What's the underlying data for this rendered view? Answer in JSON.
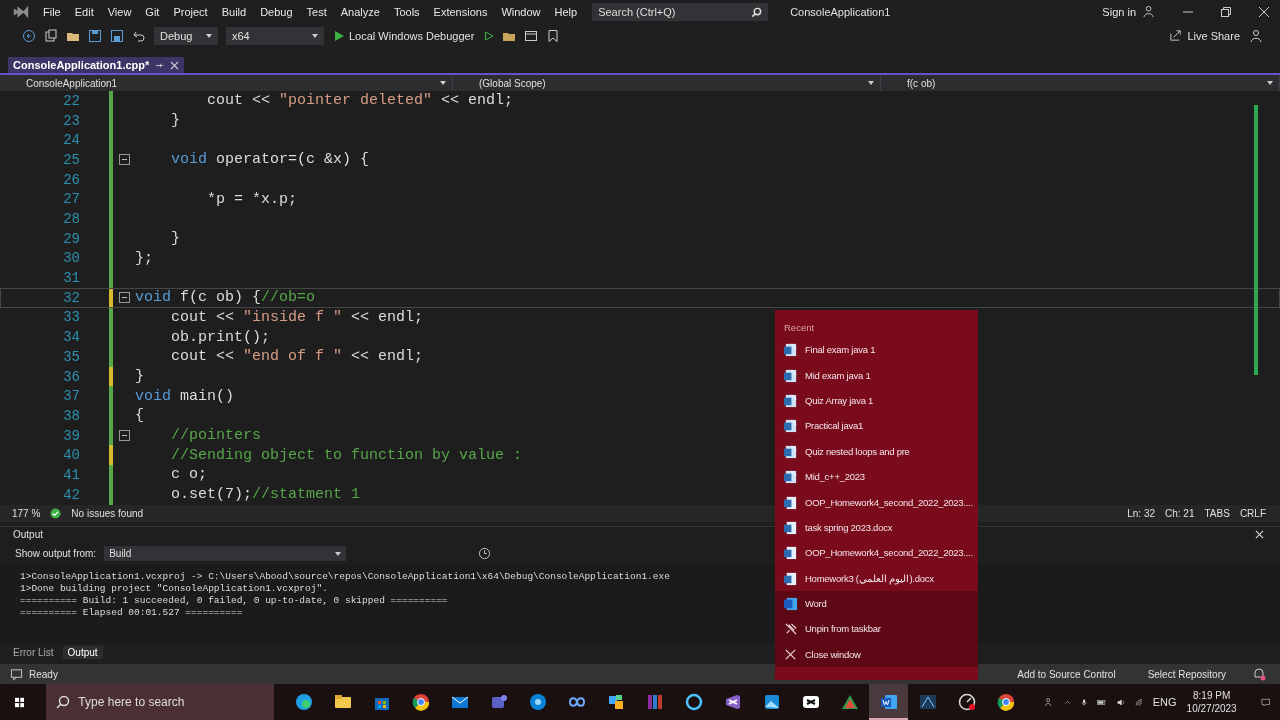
{
  "menu_bar": {
    "items": [
      "File",
      "Edit",
      "View",
      "Git",
      "Project",
      "Build",
      "Debug",
      "Test",
      "Analyze",
      "Tools",
      "Extensions",
      "Window",
      "Help"
    ],
    "search": {
      "placeholder": "Search (Ctrl+Q)"
    },
    "title": "ConsoleApplication1",
    "sign_in": "Sign in"
  },
  "toolbar": {
    "configuration": "Debug",
    "platform": "x64",
    "debugger": "Local Windows Debugger",
    "live_share": "Live Share"
  },
  "editor": {
    "tab": {
      "label": "ConsoleApplication1.cpp*",
      "selected": true
    },
    "nav": {
      "project": "ConsoleApplication1",
      "scope": "(Global Scope)",
      "member": "f(c ob)"
    },
    "lines": [
      {
        "number": "22",
        "current": false,
        "unsaved": false,
        "fold": false,
        "segments": [
          {
            "kind": "plain",
            "text": "        cout << "
          },
          {
            "kind": "string",
            "text": "\"pointer deleted\""
          },
          {
            "kind": "plain",
            "text": " << endl;"
          }
        ]
      },
      {
        "number": "23",
        "current": false,
        "unsaved": false,
        "fold": false,
        "segments": [
          {
            "kind": "plain",
            "text": "    }"
          }
        ]
      },
      {
        "number": "24",
        "current": false,
        "unsaved": false,
        "fold": false
      },
      {
        "number": "25",
        "current": false,
        "unsaved": false,
        "fold": true,
        "segments": [
          {
            "kind": "keyword",
            "text": "    void"
          },
          {
            "kind": "plain",
            "text": " operator=(c &x) {"
          }
        ]
      },
      {
        "number": "26",
        "current": false,
        "unsaved": false,
        "fold": false
      },
      {
        "number": "27",
        "current": false,
        "unsaved": false,
        "fold": false,
        "segments": [
          {
            "kind": "plain",
            "text": "        *p = *x.p;"
          }
        ]
      },
      {
        "number": "28",
        "current": false,
        "unsaved": false,
        "fold": false
      },
      {
        "number": "29",
        "current": false,
        "unsaved": false,
        "fold": false,
        "segments": [
          {
            "kind": "plain",
            "text": "    }"
          }
        ]
      },
      {
        "number": "30",
        "current": false,
        "unsaved": false,
        "fold": false,
        "segments": [
          {
            "kind": "plain",
            "text": "};"
          }
        ]
      },
      {
        "number": "31",
        "current": false,
        "unsaved": false,
        "fold": false
      },
      {
        "number": "32",
        "current": true,
        "unsaved": true,
        "fold": true,
        "segments": [
          {
            "kind": "keyword",
            "text": "void"
          },
          {
            "kind": "plain",
            "text": " f(c ob) {"
          },
          {
            "kind": "comment",
            "text": "//ob=o"
          }
        ]
      },
      {
        "number": "33",
        "current": false,
        "unsaved": false,
        "fold": false,
        "segments": [
          {
            "kind": "plain",
            "text": "    cout << "
          },
          {
            "kind": "string",
            "text": "\"inside f \""
          },
          {
            "kind": "plain",
            "text": " << endl;"
          }
        ]
      },
      {
        "number": "34",
        "current": false,
        "unsaved": false,
        "fold": false,
        "segments": [
          {
            "kind": "plain",
            "text": "    ob.print();"
          }
        ]
      },
      {
        "number": "35",
        "current": false,
        "unsaved": false,
        "fold": false,
        "segments": [
          {
            "kind": "plain",
            "text": "    cout << "
          },
          {
            "kind": "string",
            "text": "\"end of f \""
          },
          {
            "kind": "plain",
            "text": " << endl;"
          }
        ]
      },
      {
        "number": "36",
        "current": false,
        "unsaved": true,
        "fold": false,
        "segments": [
          {
            "kind": "plain",
            "text": "}"
          }
        ]
      },
      {
        "number": "37",
        "current": false,
        "unsaved": false,
        "fold": false,
        "segments": [
          {
            "kind": "keyword",
            "text": "void"
          },
          {
            "kind": "plain",
            "text": " main()"
          }
        ]
      },
      {
        "number": "38",
        "current": false,
        "unsaved": false,
        "fold": false,
        "segments": [
          {
            "kind": "plain",
            "text": "{"
          }
        ]
      },
      {
        "number": "39",
        "current": false,
        "unsaved": false,
        "fold": true,
        "segments": [
          {
            "kind": "comment",
            "text": "    //pointers"
          }
        ]
      },
      {
        "number": "40",
        "current": false,
        "unsaved": true,
        "fold": false,
        "segments": [
          {
            "kind": "comment",
            "text": "    //Sending object to function by value :"
          }
        ]
      },
      {
        "number": "41",
        "current": false,
        "unsaved": false,
        "fold": false,
        "segments": [
          {
            "kind": "plain",
            "text": "    c o;"
          }
        ]
      },
      {
        "number": "42",
        "current": false,
        "unsaved": false,
        "fold": false,
        "segments": [
          {
            "kind": "plain",
            "text": "    o.set(7);"
          },
          {
            "kind": "comment",
            "text": "//statment 1"
          }
        ]
      }
    ],
    "status": {
      "zoom": "177 %",
      "issues": "No issues found",
      "line": "Ln: 32",
      "column": "Ch: 21",
      "indent": "TABS",
      "line_endings": "CRLF"
    }
  },
  "output": {
    "title": "Output",
    "source_label": "Show output from:",
    "source": "Build",
    "lines": [
      "1>ConsoleApplication1.vcxproj -> C:\\Users\\Abood\\source\\repos\\ConsoleApplication1\\x64\\Debug\\ConsoleApplication1.exe",
      "1>Done building project \"ConsoleApplication1.vcxproj\".",
      "========== Build: 1 succeeded, 0 failed, 0 up-to-date, 0 skipped ==========",
      "========== Elapsed 00:01.527 =========="
    ],
    "tabs": [
      {
        "label": "Error List",
        "selected": false
      },
      {
        "label": "Output",
        "selected": true
      }
    ]
  },
  "status_bar": {
    "state": "Ready",
    "source_control": "Add to Source Control",
    "repository": "Select Repository"
  },
  "jump_list": {
    "header": "Recent",
    "items": [
      {
        "kind": "recent",
        "label": "Final exam java 1"
      },
      {
        "kind": "recent",
        "label": "Mid exam java 1"
      },
      {
        "kind": "recent",
        "label": "Quiz Array java 1"
      },
      {
        "kind": "recent",
        "label": "Practical java1"
      },
      {
        "kind": "recent",
        "label": "Quiz nested loops and pre"
      },
      {
        "kind": "recent",
        "label": "Mid_c++_2023"
      },
      {
        "kind": "document",
        "label": "OOP_Homework4_second_2022_2023...."
      },
      {
        "kind": "document",
        "label": "task spring 2023.docx"
      },
      {
        "kind": "document",
        "label": "OOP_Homework4_second_2022_2023...."
      },
      {
        "kind": "document",
        "label": "Homework3 (اليوم العلمي).docx"
      },
      {
        "kind": "app",
        "label": "Word"
      },
      {
        "kind": "unpin",
        "label": "Unpin from taskbar"
      },
      {
        "kind": "close",
        "label": "Close window"
      }
    ]
  },
  "taskbar": {
    "search": {
      "placeholder": "Type here to search"
    },
    "apps": [
      {
        "kind": "swirl",
        "active": false
      },
      {
        "kind": "folder",
        "active": false
      },
      {
        "kind": "bag",
        "active": false
      },
      {
        "kind": "ring",
        "active": false
      },
      {
        "kind": "mail",
        "active": false
      },
      {
        "kind": "people",
        "active": false
      },
      {
        "kind": "disc",
        "active": false
      },
      {
        "kind": "loop",
        "active": false
      },
      {
        "kind": "puzzle",
        "active": false
      },
      {
        "kind": "books",
        "active": false
      },
      {
        "kind": "circle",
        "active": false
      },
      {
        "kind": "vs",
        "active": false
      },
      {
        "kind": "photo",
        "active": false
      },
      {
        "kind": "clip",
        "active": false
      },
      {
        "kind": "triangle",
        "active": false
      },
      {
        "kind": "word",
        "active": true
      },
      {
        "kind": "network",
        "active": false
      },
      {
        "kind": "gauge",
        "active": false
      },
      {
        "kind": "ring",
        "active": false
      }
    ],
    "language": "ENG",
    "time": "8:19 PM",
    "date": "10/27/2023"
  }
}
